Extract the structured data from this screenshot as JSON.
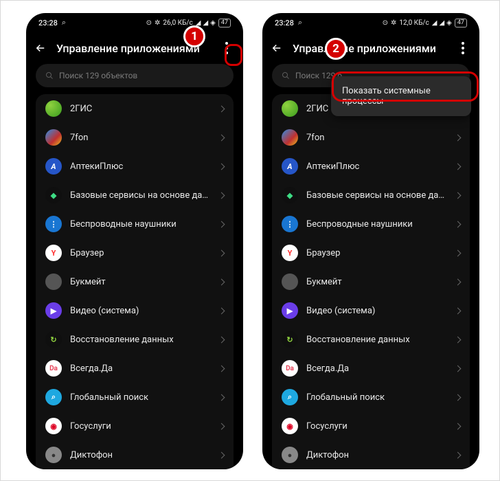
{
  "status": {
    "time": "23:28",
    "net_label": "26,0 КБ/с",
    "net_label2": "12,0 КБ/с",
    "battery": "47"
  },
  "header": {
    "title": "Управление приложениями"
  },
  "search": {
    "placeholder": "Поиск 129 объектов",
    "placeholder_short": "Поиск 129 о"
  },
  "popup": {
    "show_system": "Показать системные процессы"
  },
  "callouts": {
    "n1": "1",
    "n2": "2"
  },
  "apps": [
    {
      "name": "2ГИС",
      "icon": "ic-2gis",
      "glyph": ""
    },
    {
      "name": "7fon",
      "icon": "ic-7fon",
      "glyph": ""
    },
    {
      "name": "АптекиПлюс",
      "icon": "ic-apteki",
      "glyph": "A"
    },
    {
      "name": "Базовые сервисы на основе данных",
      "icon": "ic-android",
      "glyph": "◆"
    },
    {
      "name": "Беспроводные наушники",
      "icon": "ic-bt",
      "glyph": "⋮"
    },
    {
      "name": "Браузер",
      "icon": "ic-yandex",
      "glyph": "Y"
    },
    {
      "name": "Букмейт",
      "icon": "ic-book",
      "glyph": ""
    },
    {
      "name": "Видео (система)",
      "icon": "ic-video",
      "glyph": "▶"
    },
    {
      "name": "Восстановление данных",
      "icon": "ic-restore",
      "glyph": "↻"
    },
    {
      "name": "Всегда.Да",
      "icon": "ic-vsegda",
      "glyph": "Da"
    },
    {
      "name": "Глобальный поиск",
      "icon": "ic-search",
      "glyph": "⌕"
    },
    {
      "name": "Госуслуги",
      "icon": "ic-gos",
      "glyph": "◉"
    },
    {
      "name": "Диктофон",
      "icon": "ic-mic",
      "glyph": "●"
    }
  ]
}
